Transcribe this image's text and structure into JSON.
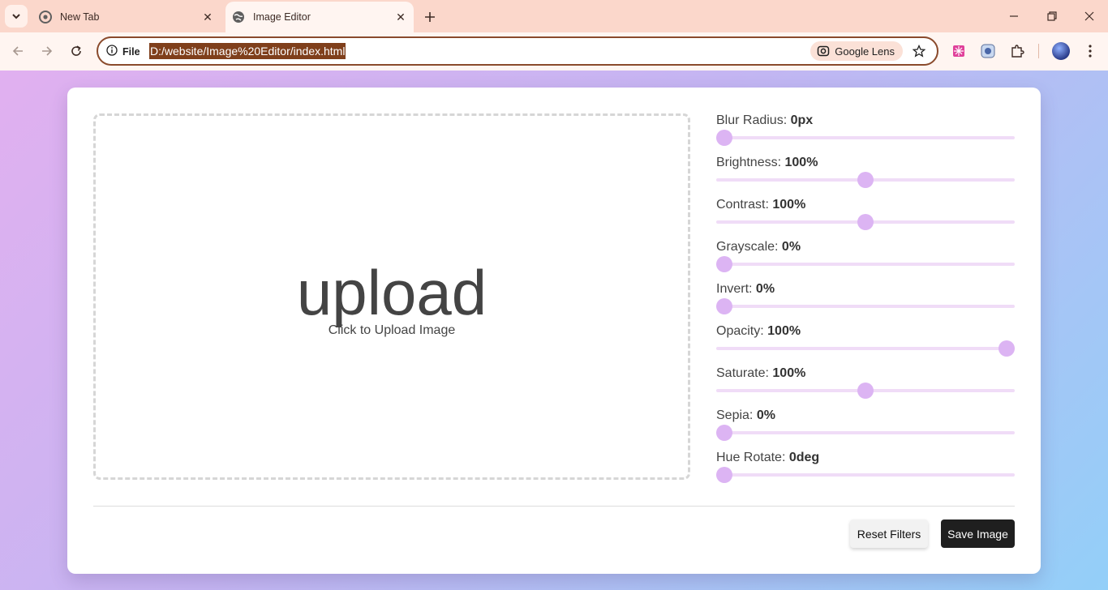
{
  "browser": {
    "tabs": [
      {
        "title": "New Tab",
        "active": false
      },
      {
        "title": "Image Editor",
        "active": true
      }
    ],
    "site_info_label": "File",
    "url": "D:/website/Image%20Editor/index.html",
    "lens_label": "Google Lens"
  },
  "editor": {
    "upload": {
      "icon_text": "upload",
      "label": "Click to Upload Image"
    },
    "filters": [
      {
        "name": "Blur Radius:",
        "value": "0px",
        "fraction": 0.0
      },
      {
        "name": "Brightness:",
        "value": "100%",
        "fraction": 0.5
      },
      {
        "name": "Contrast:",
        "value": "100%",
        "fraction": 0.5
      },
      {
        "name": "Grayscale:",
        "value": "0%",
        "fraction": 0.0
      },
      {
        "name": "Invert:",
        "value": "0%",
        "fraction": 0.0
      },
      {
        "name": "Opacity:",
        "value": "100%",
        "fraction": 1.0
      },
      {
        "name": "Saturate:",
        "value": "100%",
        "fraction": 0.5
      },
      {
        "name": "Sepia:",
        "value": "0%",
        "fraction": 0.0
      },
      {
        "name": "Hue Rotate:",
        "value": "0deg",
        "fraction": 0.0
      }
    ],
    "buttons": {
      "reset": "Reset Filters",
      "save": "Save Image"
    }
  },
  "colors": {
    "slider_thumb": "#dcb4f3",
    "slider_track": "#f0dcf7",
    "save_button": "#1f1f1f",
    "accent_frame": "#8a4a2c"
  }
}
